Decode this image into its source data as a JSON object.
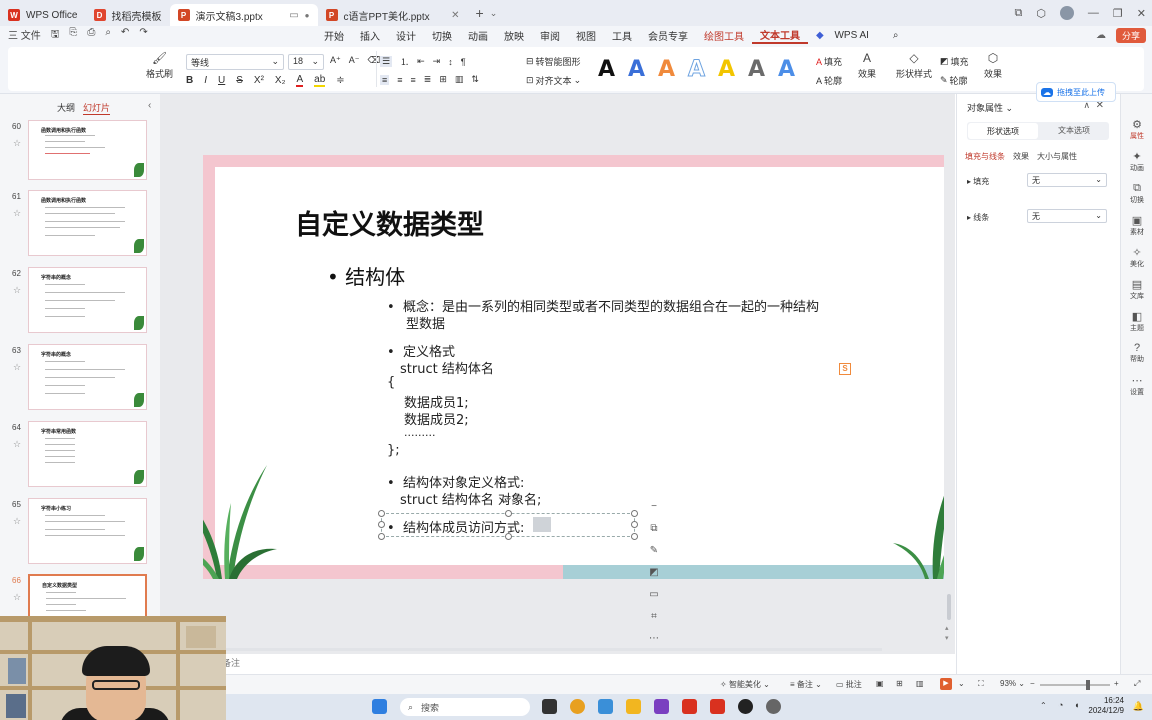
{
  "titlebar": {
    "tabs": [
      {
        "label": "WPS Office",
        "icon": "wps-logo-icon",
        "color": "#d9311f"
      },
      {
        "label": "找稻壳模板",
        "icon": "docer-logo-icon",
        "color": "#e0462f"
      },
      {
        "label": "演示文稿3.pptx",
        "icon": "ppt-file-icon",
        "color": "#d24726"
      },
      {
        "label": "c语言PPT美化.pptx",
        "icon": "ppt-file-icon",
        "color": "#d24726"
      }
    ],
    "new_tab": "+"
  },
  "menubar": {
    "file": "三 文件",
    "items": [
      "开始",
      "插入",
      "设计",
      "切换",
      "动画",
      "放映",
      "审阅",
      "视图",
      "工具",
      "会员专享",
      "绘图工具",
      "文本工具"
    ],
    "wps_ai": "WPS AI",
    "share": "分享"
  },
  "ribbon": {
    "format_painter": "格式刷",
    "font_name": "等线",
    "font_size": "18",
    "convert_smartart": "转智能图形",
    "align_text": "对齐文本",
    "fill": "填充",
    "outline": "轮廓",
    "effects": "效果",
    "shape_style": "形状样式",
    "shape_fill": "填充",
    "shape_outline": "轮廓",
    "shape_effects": "效果",
    "art_colors": [
      "#111111",
      "#3a6fd8",
      "#f08a3c",
      "#9ec5f0",
      "#f2c500",
      "#6b6b6b",
      "#4c8ee8"
    ]
  },
  "upload_tip": "拖拽至此上传",
  "leftpanel": {
    "tabs": [
      "大纲",
      "幻灯片"
    ],
    "thumbs": [
      {
        "num": "60",
        "title": "函数调用和执行函数"
      },
      {
        "num": "61",
        "title": "函数调用和执行函数"
      },
      {
        "num": "62",
        "title": "字符串的概念"
      },
      {
        "num": "63",
        "title": "字符串的概念"
      },
      {
        "num": "64",
        "title": "字符串常用函数"
      },
      {
        "num": "65",
        "title": "字符串小练习"
      },
      {
        "num": "66",
        "title": "自定义数据类型"
      }
    ]
  },
  "slide": {
    "title": "自定义数据类型",
    "bullet1": "结构体",
    "concept_line1": "概念：是由一系列的相同类型或者不同类型的数据组合在一起的一种结构",
    "concept_line2": "型数据",
    "define_format": "定义格式",
    "code_line1": "struct 结构体名",
    "code_line2": "{",
    "code_line3": "数据成员1;",
    "code_line4": "数据成员2;",
    "code_line5": ".........",
    "code_line6": "};",
    "obj_format": "结构体对象定义格式:",
    "obj_code": "struct 结构体名 对象名;",
    "member_access": "结构体成员访问方式:"
  },
  "rightpane": {
    "title": "对象属性",
    "seg": [
      "形状选项",
      "文本选项"
    ],
    "subtabs": [
      "填充与线条",
      "效果",
      "大小与属性"
    ],
    "fill_label": "填充",
    "fill_value": "无",
    "line_label": "线条",
    "line_value": "无"
  },
  "sidebar": [
    "属性",
    "动画",
    "切换",
    "素材",
    "美化",
    "文库",
    "主题",
    "帮助",
    "设置"
  ],
  "notes_placeholder": "备注",
  "statusbar": {
    "smart_beautify": "智能美化",
    "notes": "备注",
    "comments": "批注",
    "zoom": "93%"
  },
  "taskbar": {
    "search": "搜索",
    "time": "16:24",
    "date": "2024/12/9"
  }
}
